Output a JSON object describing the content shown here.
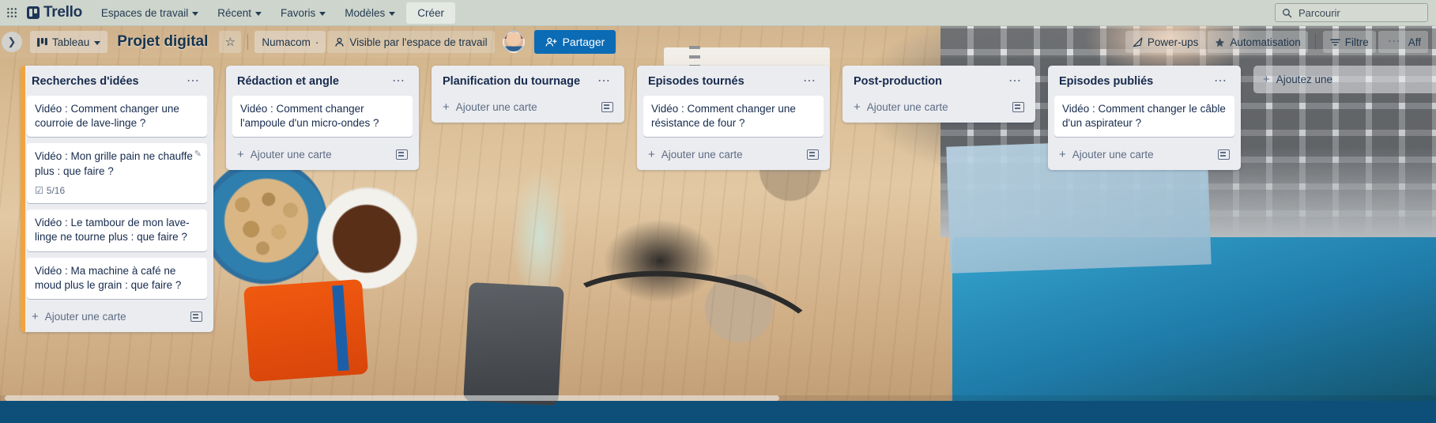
{
  "topnav": {
    "apps_icon": "grid-apps-icon",
    "brand": "Trello",
    "items": [
      {
        "label": "Espaces de travail",
        "has_caret": true
      },
      {
        "label": "Récent",
        "has_caret": true
      },
      {
        "label": "Favoris",
        "has_caret": true
      },
      {
        "label": "Modèles",
        "has_caret": true
      },
      {
        "label": "Créer",
        "has_caret": false
      }
    ],
    "search": {
      "icon": "search-icon",
      "placeholder": "Parcourir",
      "value": "Parcourir"
    }
  },
  "boardbar": {
    "collapse_icon": "chevron-right-icon",
    "board_switch": {
      "icon": "board-icon",
      "label": "Tableau",
      "caret": true
    },
    "title": "Projet digital",
    "star_icon": "star-icon",
    "workspace": "Numacom",
    "workspace_dot": "·",
    "visibility_icon": "person-icon",
    "visibility": "Visible par l'espace de travail",
    "avatar": "user-avatar",
    "share": {
      "icon": "person-add-icon",
      "label": "Partager"
    },
    "powerups": {
      "icon": "rocket-icon",
      "label": "Power-ups"
    },
    "automation": {
      "icon": "automation-icon",
      "label": "Automatisation"
    },
    "filter": {
      "icon": "filter-icon",
      "label": "Filtre"
    },
    "more": {
      "icon": "ellipsis-icon",
      "label": "Aff"
    }
  },
  "lists": [
    {
      "title": "Recherches d'idées",
      "menu_icon": "ellipsis-icon",
      "has_label_strip": true,
      "cards": [
        {
          "text": "Vidéo : Comment changer une courroie de lave-linge ?",
          "badges": []
        },
        {
          "text": "Vidéo : Mon grille pain ne chauffe plus : que faire ?",
          "edit_icon": "pencil-icon",
          "badges": [
            {
              "icon": "checklist-icon",
              "text": "5/16"
            }
          ]
        },
        {
          "text": "Vidéo : Le tambour de mon lave-linge ne tourne plus : que faire ?",
          "badges": []
        },
        {
          "text": "Vidéo : Ma machine à café ne moud plus le grain : que faire ?",
          "badges": []
        }
      ],
      "add_card": {
        "plus": "+",
        "label": "Ajouter une carte",
        "template_icon": "card-template-icon"
      }
    },
    {
      "title": "Rédaction et angle",
      "menu_icon": "ellipsis-icon",
      "has_label_strip": false,
      "cards": [
        {
          "text": "Vidéo : Comment changer l'ampoule d'un micro-ondes ?",
          "badges": []
        }
      ],
      "add_card": {
        "plus": "+",
        "label": "Ajouter une carte",
        "template_icon": "card-template-icon"
      }
    },
    {
      "title": "Planification du tournage",
      "menu_icon": "ellipsis-icon",
      "has_label_strip": false,
      "cards": [],
      "add_card": {
        "plus": "+",
        "label": "Ajouter une carte",
        "template_icon": "card-template-icon"
      }
    },
    {
      "title": "Episodes tournés",
      "menu_icon": "ellipsis-icon",
      "has_label_strip": false,
      "cards": [
        {
          "text": "Vidéo : Comment changer une résistance de four ?",
          "badges": []
        }
      ],
      "add_card": {
        "plus": "+",
        "label": "Ajouter une carte",
        "template_icon": "card-template-icon"
      }
    },
    {
      "title": "Post-production",
      "menu_icon": "ellipsis-icon",
      "has_label_strip": false,
      "cards": [],
      "add_card": {
        "plus": "+",
        "label": "Ajouter une carte",
        "template_icon": "card-template-icon"
      }
    },
    {
      "title": "Episodes publiés",
      "menu_icon": "ellipsis-icon",
      "has_label_strip": false,
      "cards": [
        {
          "text": "Vidéo : Comment changer le câble d'un aspirateur ?",
          "badges": []
        }
      ],
      "add_card": {
        "plus": "+",
        "label": "Ajouter une carte",
        "template_icon": "card-template-icon"
      }
    }
  ],
  "add_list": {
    "plus": "+",
    "label": "Ajoutez une"
  },
  "colors": {
    "nav_bg": "#ced5cc",
    "list_bg": "#ebecf0",
    "card_bg": "#ffffff",
    "text_primary": "#172b4d",
    "text_muted": "#5e6c84",
    "share_blue": "#0b6bb5",
    "label_orange": "#f2a33c"
  }
}
